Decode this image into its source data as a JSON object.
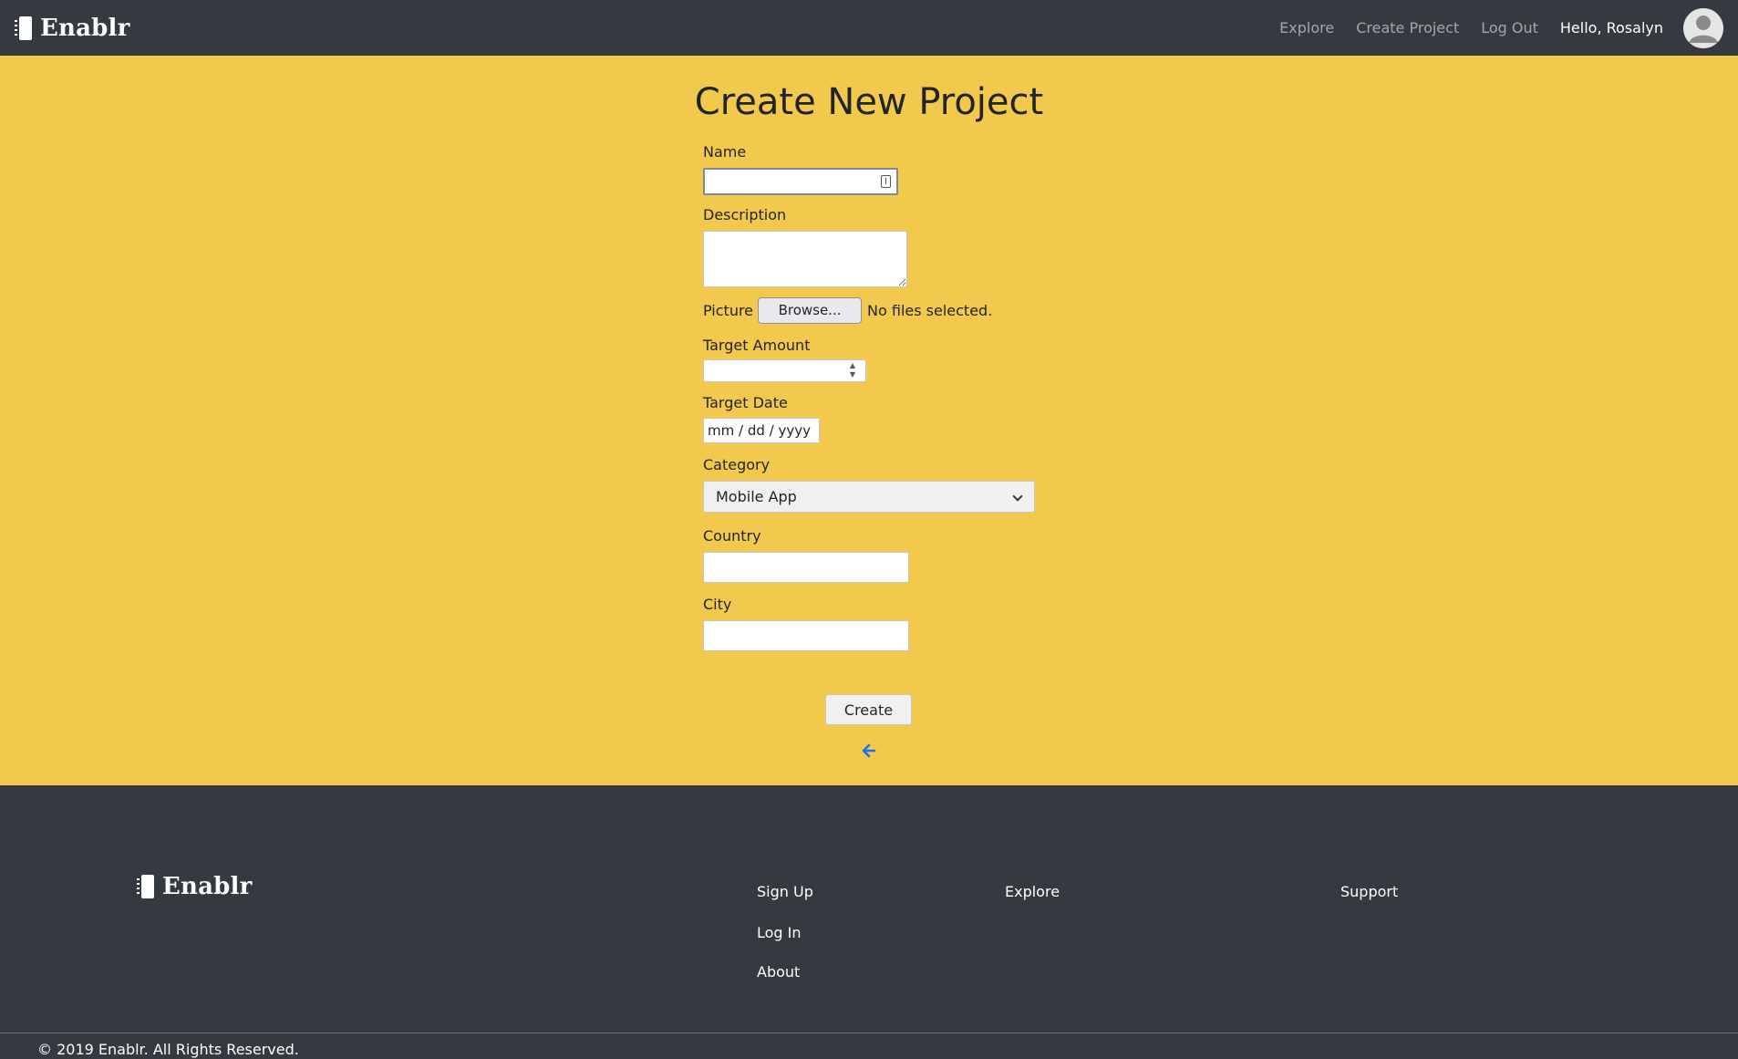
{
  "nav": {
    "brand": "Enablr",
    "links": [
      "Explore",
      "Create Project",
      "Log Out"
    ],
    "greeting": "Hello, Rosalyn"
  },
  "form": {
    "title": "Create New Project",
    "name_label": "Name",
    "name_value": "",
    "description_label": "Description",
    "description_value": "",
    "picture_label": "Picture",
    "browse_label": "Browse...",
    "no_files_text": "No files selected.",
    "target_amount_label": "Target Amount",
    "target_amount_value": "",
    "target_date_label": "Target Date",
    "target_date_placeholder": "mm / dd / yyyy",
    "category_label": "Category",
    "category_selected": "Mobile App",
    "country_label": "Country",
    "country_value": "",
    "city_label": "City",
    "city_value": "",
    "create_label": "Create",
    "back_icon": "arrow-left-icon"
  },
  "footer": {
    "brand": "Enablr",
    "links_col1": [
      "Sign Up",
      "Log In",
      "About"
    ],
    "link_explore": "Explore",
    "link_support": "Support",
    "copyright": "© 2019 Enablr. All Rights Reserved."
  },
  "colors": {
    "nav_bg": "#343a40",
    "main_bg": "#f2c94c",
    "accent": "#1a73e8"
  }
}
